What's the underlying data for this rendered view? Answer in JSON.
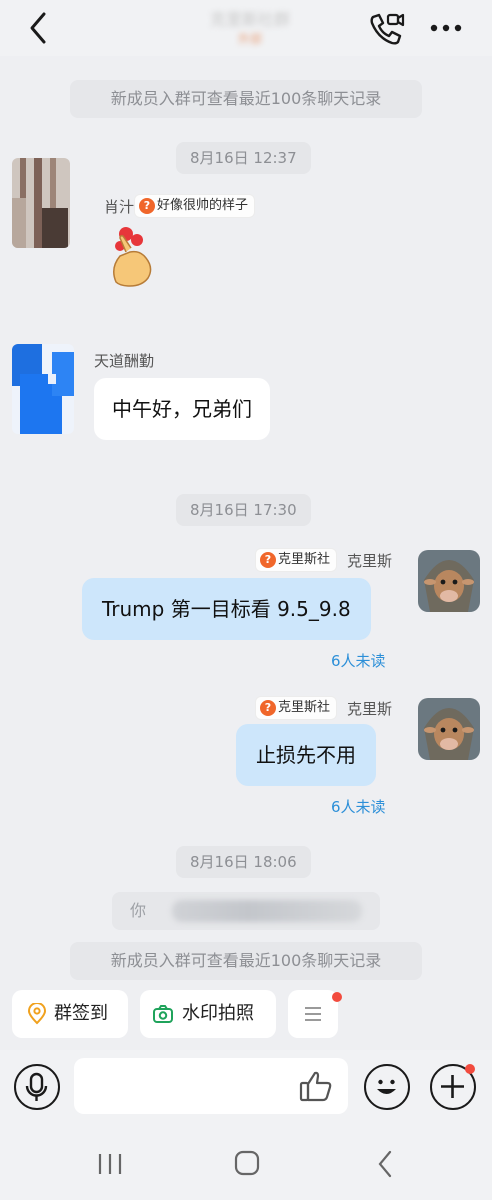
{
  "header": {
    "title": "克里斯社群",
    "title_badge": "外部"
  },
  "chat": {
    "notice_top": "新成员入群可查看最近100条聊天记录",
    "notice_bottom": "新成员入群可查看最近100条聊天记录",
    "messages": [
      {
        "time": "8月16日 12:37",
        "sender": "肖汁",
        "tag": "好像很帅的样子",
        "content_emoji": "👌"
      },
      {
        "sender": "天道酬勤",
        "content": "中午好，兄弟们"
      },
      {
        "time": "8月16日 17:30",
        "sender": "克里斯",
        "tag": "克里斯社",
        "content": "Trump 第一目标看 9.5_9.8",
        "read_status": "6人未读"
      },
      {
        "sender": "克里斯",
        "tag": "克里斯社",
        "content": "止损先不用",
        "read_status": "6人未读"
      }
    ],
    "time_last": "8月16日 18:06",
    "system_line": "你邀请…加入群聊",
    "system_line_visible": "你"
  },
  "quick_actions": [
    {
      "label": "群签到",
      "icon": "location-pin-icon"
    },
    {
      "label": "水印拍照",
      "icon": "camera-icon"
    },
    {
      "label": "",
      "icon": "menu-icon"
    }
  ],
  "input": {
    "placeholder": ""
  },
  "colors": {
    "bg": "#eeeff2",
    "bubble_self": "#cde6fb",
    "read_status": "#2c8fd8",
    "tag_icon": "#f0662a",
    "red_dot": "#f24b3e"
  }
}
